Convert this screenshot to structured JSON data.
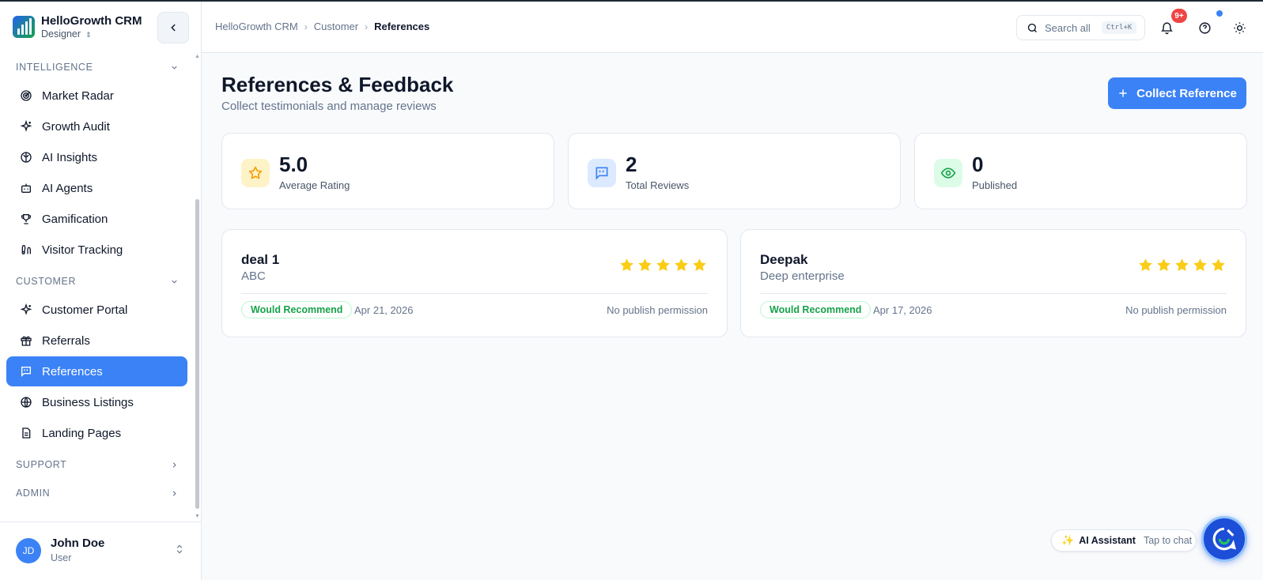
{
  "brand": {
    "name": "HelloGrowth CRM",
    "role": "Designer"
  },
  "sidebar": {
    "sections": {
      "intelligence": "INTELLIGENCE",
      "customer": "CUSTOMER",
      "support": "SUPPORT",
      "admin": "ADMIN"
    },
    "intelligence_items": [
      {
        "label": "Market Radar",
        "icon": "radar-icon"
      },
      {
        "label": "Growth Audit",
        "icon": "sparkles-icon"
      },
      {
        "label": "AI Insights",
        "icon": "brain-icon"
      },
      {
        "label": "AI Agents",
        "icon": "bot-icon"
      },
      {
        "label": "Gamification",
        "icon": "trophy-icon"
      },
      {
        "label": "Visitor Tracking",
        "icon": "footprints-icon"
      }
    ],
    "customer_items": [
      {
        "label": "Customer Portal",
        "icon": "sparkles-icon"
      },
      {
        "label": "Referrals",
        "icon": "gift-icon"
      },
      {
        "label": "References",
        "icon": "message-quote-icon"
      },
      {
        "label": "Business Listings",
        "icon": "globe-icon"
      },
      {
        "label": "Landing Pages",
        "icon": "file-text-icon"
      }
    ],
    "active": "References"
  },
  "user": {
    "initials": "JD",
    "name": "John Doe",
    "role": "User"
  },
  "topbar": {
    "breadcrumb": [
      "HelloGrowth CRM",
      "Customer",
      "References"
    ],
    "search_label": "Search all",
    "search_shortcut": "Ctrl+K",
    "notifications_badge": "9+"
  },
  "page": {
    "title": "References & Feedback",
    "subtitle": "Collect testimonials and manage reviews",
    "primary_action": "Collect Reference"
  },
  "stats": [
    {
      "value": "5.0",
      "label": "Average Rating",
      "icon": "star-icon",
      "color": "#f59e0b",
      "bg": "#fef3c7"
    },
    {
      "value": "2",
      "label": "Total Reviews",
      "icon": "message-quote-icon",
      "color": "#3b82f6",
      "bg": "#dbeafe"
    },
    {
      "value": "0",
      "label": "Published",
      "icon": "eye-icon",
      "color": "#16a34a",
      "bg": "#dcfce7"
    }
  ],
  "references": [
    {
      "name": "deal 1",
      "company": "ABC",
      "rating": 5,
      "tag": "Would Recommend",
      "date": "Apr 21, 2026",
      "permission": "No publish permission"
    },
    {
      "name": "Deepak",
      "company": "Deep enterprise",
      "rating": 5,
      "tag": "Would Recommend",
      "date": "Apr 17, 2026",
      "permission": "No publish permission"
    }
  ],
  "ai_assistant": {
    "label": "AI Assistant",
    "hint": "Tap to chat"
  },
  "colors": {
    "accent": "#3b82f6",
    "success": "#16a34a",
    "star": "#facc15",
    "danger": "#ef4444"
  }
}
